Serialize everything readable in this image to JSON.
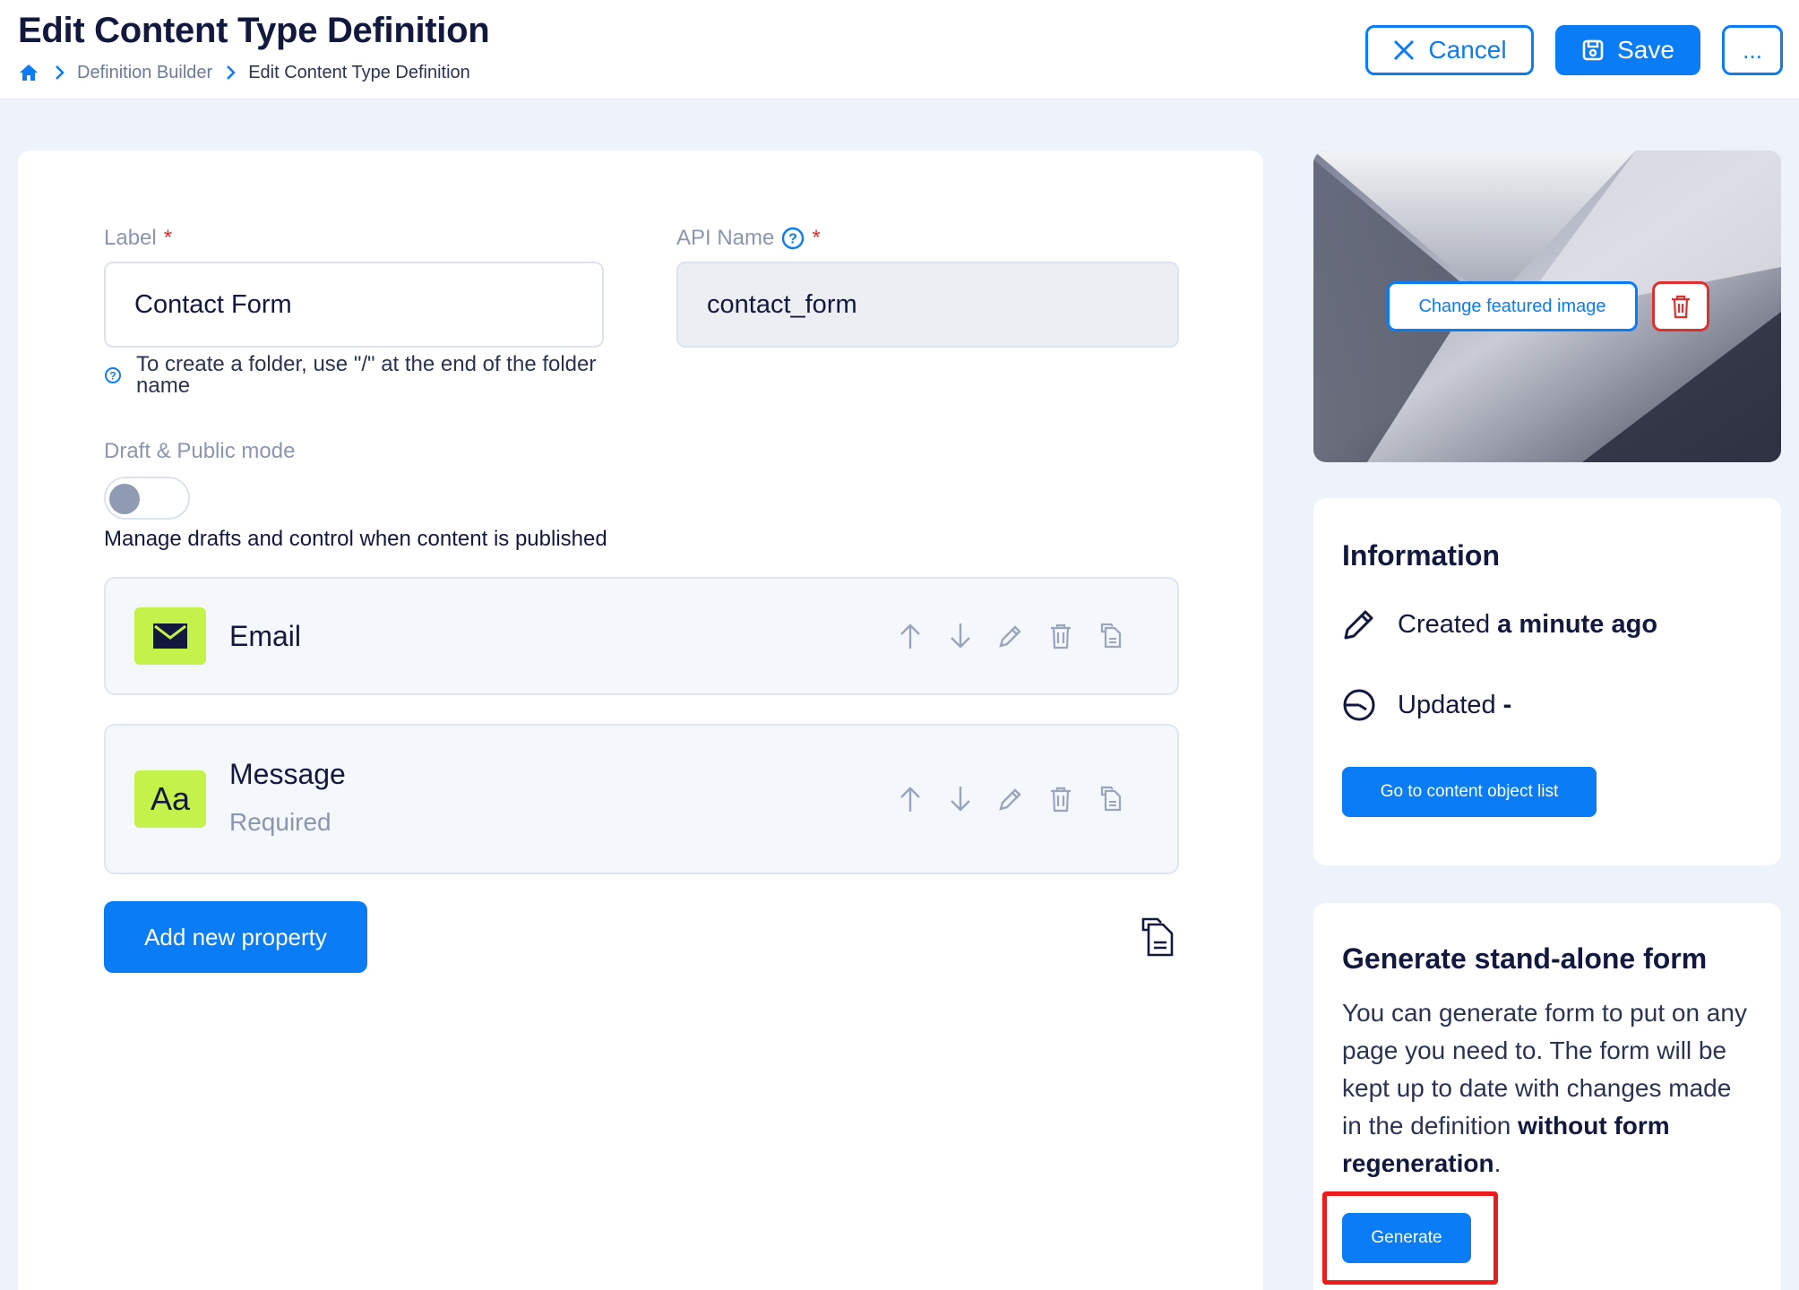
{
  "header": {
    "title": "Edit Content Type Definition",
    "breadcrumb": [
      "Definition Builder",
      "Edit Content Type Definition"
    ],
    "cancel_label": "Cancel",
    "save_label": "Save",
    "more_label": "..."
  },
  "form": {
    "label_title": "Label",
    "label_value": "Contact Form",
    "label_hint": "To create a folder, use \"/\" at the end of the folder name",
    "api_title": "API Name",
    "api_value": "contact_form",
    "required_mark": "*",
    "mode_title": "Draft & Public mode",
    "mode_enabled": false,
    "mode_desc": "Manage drafts and control when content is published"
  },
  "properties": [
    {
      "name": "Email",
      "sub": "",
      "icon": "envelope-icon"
    },
    {
      "name": "Message",
      "sub": "Required",
      "icon": "text-aa-icon"
    }
  ],
  "add_property_label": "Add new property",
  "featured_image": {
    "change_label": "Change featured image"
  },
  "information": {
    "title": "Information",
    "created_label": "Created",
    "created_value": "a minute ago",
    "updated_label": "Updated",
    "updated_value": "-",
    "list_button": "Go to content object list"
  },
  "generate": {
    "title": "Generate stand-alone form",
    "desc": "You can generate form to put on any page you need to. The form will be kept up to date with changes made in the definition",
    "desc_bold": "without form regeneration",
    "desc_end": ".",
    "button": "Generate"
  },
  "colors": {
    "accent": "#0a7cf5",
    "danger": "#e0302e",
    "prop_icon_bg": "#c4f24a"
  }
}
